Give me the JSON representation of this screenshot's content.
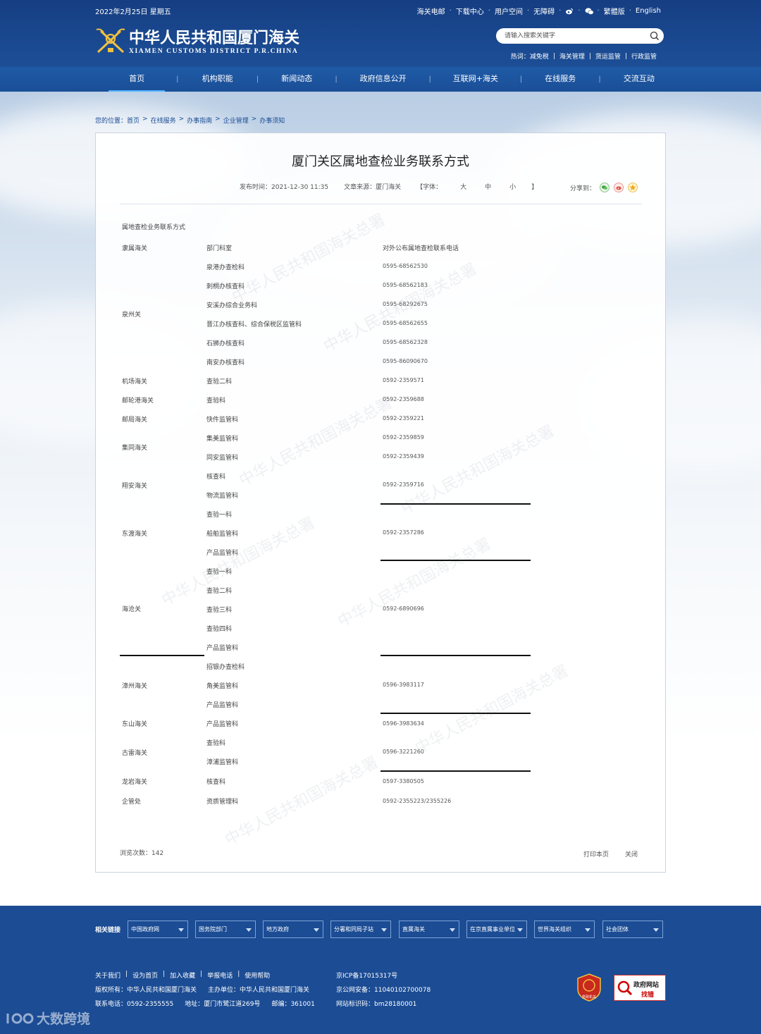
{
  "header": {
    "date": "2022年2月25日 星期五",
    "top_links": [
      "海关电邮",
      "下载中心",
      "用户空间",
      "无障碍"
    ],
    "icons": [
      "weibo-icon",
      "wechat-icon"
    ],
    "trad": "繁體版",
    "english": "English",
    "logo_cn": "中华人民共和国厦门海关",
    "logo_en": "XIAMEN CUSTOMS DISTRICT P.R.CHINA",
    "search_placeholder": "请输入搜索关键字",
    "hot_label": "热词：",
    "hot_words": [
      "减免税",
      "海关管理",
      "货运监管",
      "行政监管"
    ]
  },
  "nav": [
    "首页",
    "机构职能",
    "新闻动态",
    "政府信息公开",
    "互联网+海关",
    "在线服务",
    "交流互动"
  ],
  "breadcrumb": [
    "您的位置：首页",
    "在线服务",
    "办事指南",
    "企业管理",
    "办事须知"
  ],
  "article": {
    "title": "厦门关区属地查检业务联系方式",
    "publish_time": "发布时间：2021-12-30 11:35",
    "source": "文章来源：厦门海关",
    "font_label": "【字体：",
    "font_sizes": [
      "大",
      "中",
      "小"
    ],
    "font_end": "】",
    "share_label": "分享到：",
    "sub_title": "属地查检业务联系方式",
    "table": {
      "headers": [
        "隶属海关",
        "部门科室",
        "对外公布属地查检联系电话"
      ],
      "col1": [
        "泉州关",
        "机场海关",
        "邮轮港海关",
        "邮局海关",
        "集同海关",
        "翔安海关",
        "东渡海关",
        "海沧关",
        "漳州海关",
        "东山海关",
        "古雷海关",
        "龙岩海关",
        "企管处"
      ],
      "col2": [
        "泉港办查检科",
        "刺桐办核查科",
        "安溪办综合业务科",
        "晋江办核查科、综合保税区监管科",
        "石狮办核查科",
        "南安办核查科",
        "查验二科",
        "查验科",
        "快件监管科",
        "集美监管科",
        "同安监管科",
        "核查科",
        "物流监管科",
        "查验一科",
        "船舶监管科",
        "产品监管科",
        "查验一科",
        "查验二科",
        "查验三科",
        "查验四科",
        "产品监管科",
        "招银办查检科",
        "角美监管科",
        "产品监管科",
        "产品监管科",
        "查验科",
        "漳浦监管科",
        "核查科",
        "资质管理科"
      ],
      "col3": [
        "0595-68562530",
        "0595-68562183",
        "0595-68292675",
        "0595-68562655",
        "0595-68562328",
        "0595-86090670",
        "0592-2359571",
        "0592-2359688",
        "0592-2359221",
        "0592-2359859",
        "0592-2359439",
        "0592-2359716",
        "0592-2357286",
        "0592-6890696",
        "0596-3983117",
        "0596-3983634",
        "0596-3221260",
        "0597-3380505",
        "0592-2355223/2355226"
      ]
    },
    "views": "浏览次数：142",
    "print": "打印本页",
    "close": "关闭"
  },
  "footer": {
    "related_label": "相关链接",
    "selects": [
      "中国政府网",
      "国务院部门",
      "地方政府",
      "分署和同局子站",
      "直属海关",
      "在京直属事业单位",
      "世界海关组织",
      "社会团体"
    ],
    "links": [
      "关于我们",
      "设为首页",
      "加入收藏",
      "举报电话",
      "使用帮助"
    ],
    "line2": [
      "版权所有：中华人民共和国厦门海关",
      "主办单位：中华人民共和国厦门海关"
    ],
    "line3": [
      "联系电话：0592-2355555",
      "地址：厦门市鹭江道269号",
      "邮编：361001"
    ],
    "right": [
      "京ICP备17015317号",
      "京公网安备：11040102700078",
      "网站标识码：bm28180001"
    ],
    "badge_label_top": "政府网站",
    "badge_label_bottom": "找错",
    "badge1_text": "党政机关"
  },
  "brand_watermark": "大数跨境",
  "colors": {
    "primary": "#1b4c94",
    "nav": "#1f5aa6",
    "accent": "#4fb3ff"
  }
}
